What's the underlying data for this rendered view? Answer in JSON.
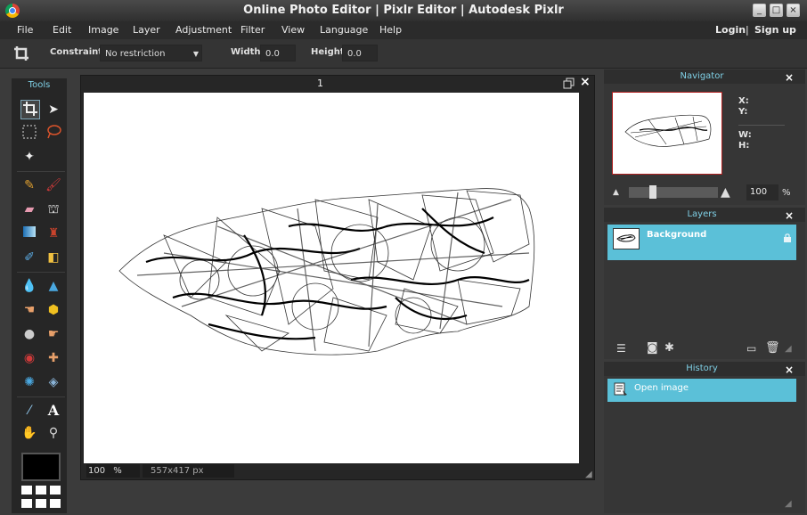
{
  "window": {
    "title": "Online Photo Editor | Pixlr Editor | Autodesk Pixlr",
    "controls": [
      "_",
      "□",
      "×"
    ]
  },
  "menu": {
    "items": [
      "File",
      "Edit",
      "Image",
      "Layer",
      "Adjustment",
      "Filter",
      "View",
      "Language",
      "Help"
    ],
    "login": "Login",
    "separator": "|",
    "signup": "Sign up"
  },
  "options": {
    "constraint_label": "Constraint:",
    "constraint_value": "No restriction",
    "width_label": "Width:",
    "width_value": "0.0",
    "height_label": "Height:",
    "height_value": "0.0"
  },
  "tools": {
    "title": "Tools",
    "icons": [
      "crop-icon",
      "move-icon",
      "marquee-icon",
      "lasso-icon",
      "magic-wand-icon",
      "pencil-icon",
      "brush-icon",
      "eraser-icon",
      "paint-bucket-icon",
      "gradient-icon",
      "clone-stamp-icon",
      "color-replace-icon",
      "drawing-icon",
      "blur-icon",
      "sharpen-icon",
      "smudge-icon",
      "sponge-icon",
      "burn-icon",
      "dodge-icon",
      "red-eye-icon",
      "spot-heal-icon",
      "bloat-icon",
      "pinch-icon",
      "color-picker-icon",
      "type-icon",
      "hand-icon",
      "zoom-icon"
    ],
    "primary_color": "#000000",
    "secondary_color": "#ffffff"
  },
  "canvas": {
    "tab_title": "1",
    "zoom": "100",
    "zoom_unit": "%",
    "dimensions": "557x417 px",
    "background": "#ffffff"
  },
  "navigator": {
    "title": "Navigator",
    "x_label": "X:",
    "y_label": "Y:",
    "w_label": "W:",
    "h_label": "H:",
    "zoom_value": "100",
    "zoom_unit": "%",
    "frame_color": "#b02020"
  },
  "layers": {
    "title": "Layers",
    "items": [
      {
        "name": "Background",
        "locked": true
      }
    ],
    "accent": "#5bc0d8"
  },
  "history": {
    "title": "History",
    "items": [
      {
        "name": "Open image"
      }
    ],
    "accent": "#5bc0d8"
  }
}
